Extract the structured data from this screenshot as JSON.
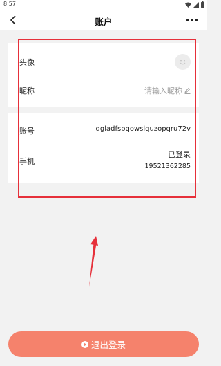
{
  "status_bar": {
    "time": "8:57"
  },
  "nav": {
    "title": "账户"
  },
  "profile": {
    "avatar_label": "头像",
    "nickname_label": "昵称",
    "nickname_placeholder": "请输入昵称"
  },
  "account": {
    "account_label": "账号",
    "account_value": "dgladfspqowslquzopqru72v",
    "phone_label": "手机",
    "phone_status": "已登录",
    "phone_number": "19521362285"
  },
  "logout": {
    "label": "退出登录"
  },
  "colors": {
    "highlight": "#e6303a",
    "logout_button": "#f5826c"
  }
}
